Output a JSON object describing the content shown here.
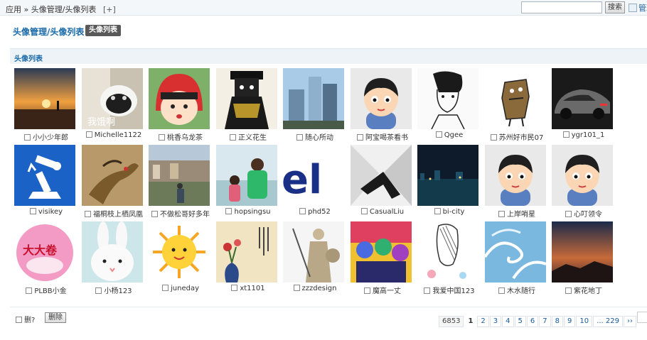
{
  "header": {
    "breadcrumb": "应用 » 头像管理/头像列表",
    "add": "[+]",
    "search_placeholder": "",
    "search_button": "搜索",
    "admin_link": "管理"
  },
  "title": {
    "link": "头像管理/头像列表",
    "badge": "头像列表"
  },
  "section": {
    "heading": "头像列表"
  },
  "avatars": [
    {
      "name": "小小少年郎",
      "icon": "sunset-photo"
    },
    {
      "name": "Michelle1122",
      "icon": "cat-photo"
    },
    {
      "name": "桃香乌龙茶",
      "icon": "cartoon-girl"
    },
    {
      "name": "正义花生",
      "icon": "armor-figure"
    },
    {
      "name": "随心所动",
      "icon": "skyscraper-photo"
    },
    {
      "name": "阿宝喝茶看书",
      "icon": "default-avatar"
    },
    {
      "name": "Qgee",
      "icon": "sketch-portrait"
    },
    {
      "name": "苏州好市民07",
      "icon": "monster-doodle"
    },
    {
      "name": "ygr101_1",
      "icon": "sports-car"
    },
    {
      "name": "visikey",
      "icon": "robot-arm-logo"
    },
    {
      "name": "福桐枝上栖凤凰",
      "icon": "phoenix-painting"
    },
    {
      "name": "不做松哥好多年",
      "icon": "city-street-photo"
    },
    {
      "name": "hopsingsu",
      "icon": "father-child-photo"
    },
    {
      "name": "phd52",
      "icon": "el-logo"
    },
    {
      "name": "CasualLiu",
      "icon": "architecture-photo"
    },
    {
      "name": "bi-city",
      "icon": "night-city"
    },
    {
      "name": "上岸哨星",
      "icon": "default-avatar"
    },
    {
      "name": "心叮领令",
      "icon": "default-avatar"
    },
    {
      "name": "PLBB小金",
      "icon": "cake-cartoon"
    },
    {
      "name": "小杨123",
      "icon": "white-rabbit"
    },
    {
      "name": "juneday",
      "icon": "sun-cartoon"
    },
    {
      "name": "xt1101",
      "icon": "flower-vase-painting"
    },
    {
      "name": "zzzdesign",
      "icon": "statue-photo"
    },
    {
      "name": "魔高一丈",
      "icon": "colorful-characters"
    },
    {
      "name": "我爱中国123",
      "icon": "sketch-girl"
    },
    {
      "name": "木水随行",
      "icon": "wave-painting"
    },
    {
      "name": "紫花地丁",
      "icon": "painted-sky"
    }
  ],
  "footer": {
    "select_all": "删?",
    "delete_button": "删除",
    "pager": {
      "total": "6853",
      "current": "1",
      "pages": [
        "2",
        "3",
        "4",
        "5",
        "6",
        "7",
        "8",
        "9",
        "10"
      ],
      "last": "... 229",
      "next": "››"
    }
  }
}
